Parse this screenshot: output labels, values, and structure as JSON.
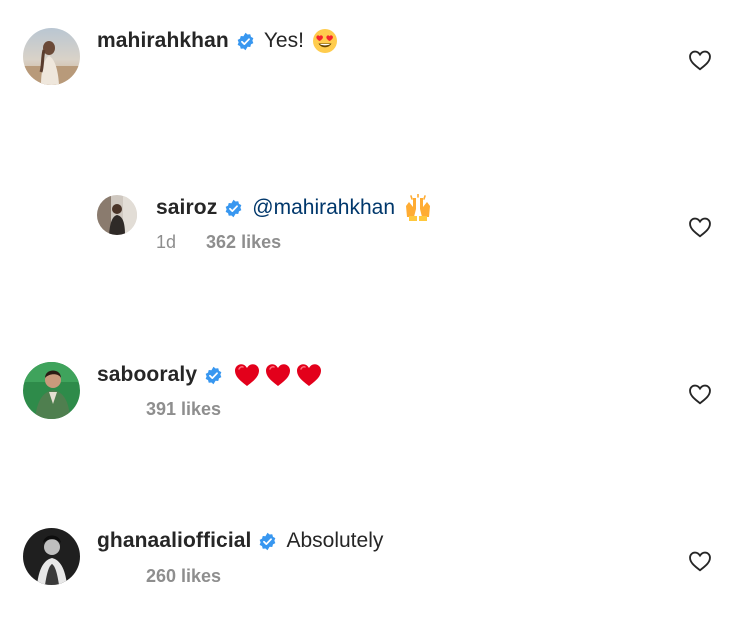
{
  "comments": [
    {
      "username": "mahirahkhan",
      "text": "Yes!",
      "emoji": "heart-eyes-emoji",
      "time": "",
      "likes": ""
    },
    {
      "username": "sairoz",
      "mention": "@mahirahkhan",
      "emoji": "raising-hands-emoji",
      "time": "1d",
      "likes": "362 likes"
    },
    {
      "username": "sabooraly",
      "emoji": "red-heart-emoji x3",
      "time": "",
      "likes": "391 likes"
    },
    {
      "username": "ghanaaliofficial",
      "text": "Absolutely",
      "time": "",
      "likes": "260 likes"
    }
  ],
  "colors": {
    "verified_badge": "#3897f0",
    "mention": "#00376b",
    "meta_text": "#8e8e8e",
    "username": "#262626"
  }
}
